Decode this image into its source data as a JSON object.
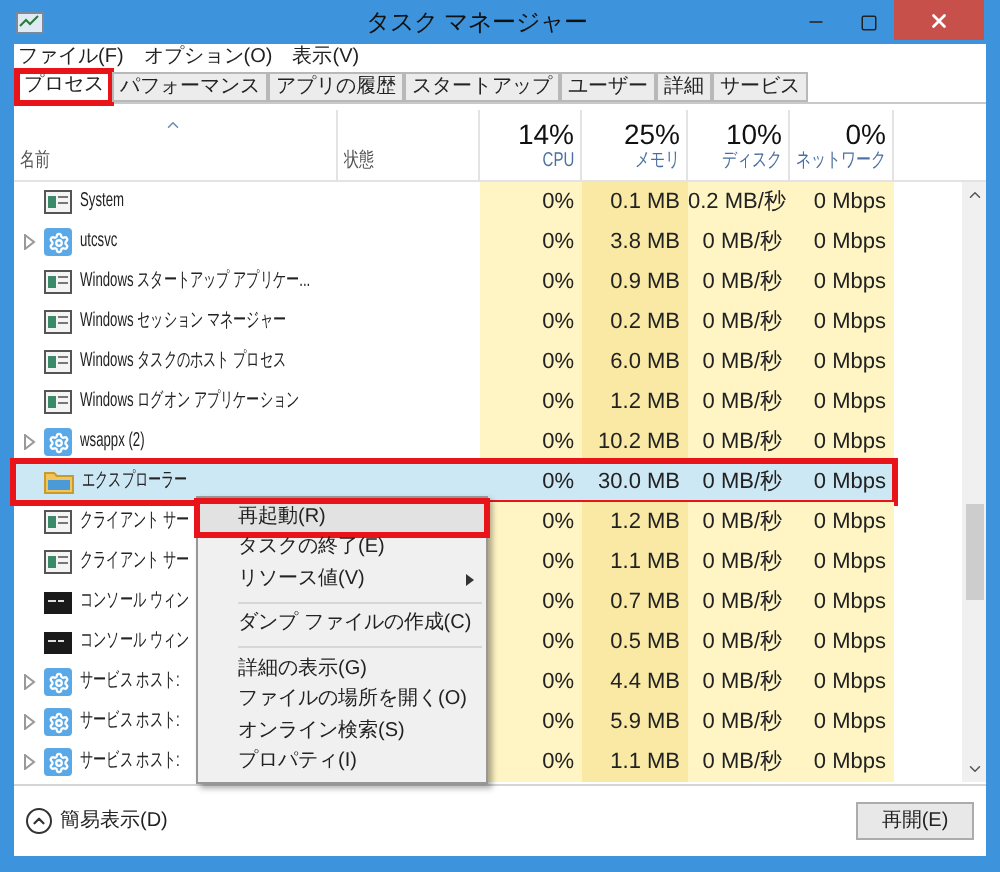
{
  "window": {
    "title": "タスク マネージャー"
  },
  "menu": [
    "ファイル(F)",
    "オプション(O)",
    "表示(V)"
  ],
  "tabs": [
    {
      "label": "プロセス",
      "selected": true,
      "highlighted": true
    },
    {
      "label": "パフォーマンス",
      "selected": false,
      "highlighted": false
    },
    {
      "label": "アプリの履歴",
      "selected": false,
      "highlighted": false
    },
    {
      "label": "スタートアップ",
      "selected": false,
      "highlighted": false
    },
    {
      "label": "ユーザー",
      "selected": false,
      "highlighted": false
    },
    {
      "label": "詳細",
      "selected": false,
      "highlighted": false
    },
    {
      "label": "サービス",
      "selected": false,
      "highlighted": false
    }
  ],
  "columns": [
    {
      "label": "名前"
    },
    {
      "label": "状態"
    },
    {
      "percent": "14%",
      "label": "CPU"
    },
    {
      "percent": "25%",
      "label": "メモリ"
    },
    {
      "percent": "10%",
      "label": "ディスク"
    },
    {
      "percent": "0%",
      "label": "ネットワーク"
    }
  ],
  "rows": [
    {
      "name": "System",
      "kind": "window",
      "expandable": false,
      "selected": false,
      "highlighted": false,
      "cpu": "0%",
      "memory": "0.1 MB",
      "disk": "0.2 MB/秒",
      "network": "0 Mbps"
    },
    {
      "name": "utcsvc",
      "kind": "service",
      "expandable": true,
      "selected": false,
      "highlighted": false,
      "cpu": "0%",
      "memory": "3.8 MB",
      "disk": "0 MB/秒",
      "network": "0 Mbps"
    },
    {
      "name": "Windows スタートアップ アプリケー...",
      "kind": "window",
      "expandable": false,
      "selected": false,
      "highlighted": false,
      "cpu": "0%",
      "memory": "0.9 MB",
      "disk": "0 MB/秒",
      "network": "0 Mbps"
    },
    {
      "name": "Windows セッション マネージャー",
      "kind": "window",
      "expandable": false,
      "selected": false,
      "highlighted": false,
      "cpu": "0%",
      "memory": "0.2 MB",
      "disk": "0 MB/秒",
      "network": "0 Mbps"
    },
    {
      "name": "Windows タスクのホスト プロセス",
      "kind": "window",
      "expandable": false,
      "selected": false,
      "highlighted": false,
      "cpu": "0%",
      "memory": "6.0 MB",
      "disk": "0 MB/秒",
      "network": "0 Mbps"
    },
    {
      "name": "Windows ログオン アプリケーション",
      "kind": "window",
      "expandable": false,
      "selected": false,
      "highlighted": false,
      "cpu": "0%",
      "memory": "1.2 MB",
      "disk": "0 MB/秒",
      "network": "0 Mbps"
    },
    {
      "name": "wsappx (2)",
      "kind": "service",
      "expandable": true,
      "selected": false,
      "highlighted": false,
      "cpu": "0%",
      "memory": "10.2 MB",
      "disk": "0 MB/秒",
      "network": "0 Mbps"
    },
    {
      "name": "エクスプローラー",
      "kind": "explorer",
      "expandable": false,
      "selected": true,
      "highlighted": true,
      "cpu": "0%",
      "memory": "30.0 MB",
      "disk": "0 MB/秒",
      "network": "0 Mbps"
    },
    {
      "name": "クライアント サー",
      "kind": "window",
      "expandable": false,
      "selected": false,
      "highlighted": false,
      "cpu": "0%",
      "memory": "1.2 MB",
      "disk": "0 MB/秒",
      "network": "0 Mbps"
    },
    {
      "name": "クライアント サー",
      "kind": "window",
      "expandable": false,
      "selected": false,
      "highlighted": false,
      "cpu": "0%",
      "memory": "1.1 MB",
      "disk": "0 MB/秒",
      "network": "0 Mbps"
    },
    {
      "name": "コンソール ウィン",
      "kind": "console",
      "expandable": false,
      "selected": false,
      "highlighted": false,
      "cpu": "0%",
      "memory": "0.7 MB",
      "disk": "0 MB/秒",
      "network": "0 Mbps"
    },
    {
      "name": "コンソール ウィン",
      "kind": "console",
      "expandable": false,
      "selected": false,
      "highlighted": false,
      "cpu": "0%",
      "memory": "0.5 MB",
      "disk": "0 MB/秒",
      "network": "0 Mbps"
    },
    {
      "name": "サービス ホスト:",
      "kind": "service",
      "expandable": true,
      "selected": false,
      "highlighted": false,
      "cpu": "0%",
      "memory": "4.4 MB",
      "disk": "0 MB/秒",
      "network": "0 Mbps"
    },
    {
      "name": "サービス ホスト:",
      "kind": "service",
      "expandable": true,
      "selected": false,
      "highlighted": false,
      "cpu": "0%",
      "memory": "5.9 MB",
      "disk": "0 MB/秒",
      "network": "0 Mbps"
    },
    {
      "name": "サービス ホスト:",
      "kind": "service",
      "expandable": true,
      "selected": false,
      "highlighted": false,
      "cpu": "0%",
      "memory": "1.1 MB",
      "disk": "0 MB/秒",
      "network": "0 Mbps"
    }
  ],
  "context_menu": {
    "items": [
      {
        "kind": "item",
        "label": "再起動(R)",
        "selected": true,
        "highlighted": true
      },
      {
        "kind": "item",
        "label": "タスクの終了(E)",
        "selected": false,
        "highlighted": false
      },
      {
        "kind": "submenu",
        "label": "リソース値(V)",
        "selected": false,
        "highlighted": false
      },
      {
        "kind": "separator"
      },
      {
        "kind": "item",
        "label": "ダンプ ファイルの作成(C)",
        "selected": false,
        "highlighted": false
      },
      {
        "kind": "separator"
      },
      {
        "kind": "item",
        "label": "詳細の表示(G)",
        "selected": false,
        "highlighted": false
      },
      {
        "kind": "item",
        "label": "ファイルの場所を開く(O)",
        "selected": false,
        "highlighted": false
      },
      {
        "kind": "item",
        "label": "オンライン検索(S)",
        "selected": false,
        "highlighted": false
      },
      {
        "kind": "item",
        "label": "プロパティ(I)",
        "selected": false,
        "highlighted": false
      }
    ]
  },
  "footer": {
    "toggle": "簡易表示(D)",
    "button": "再開(E)"
  }
}
